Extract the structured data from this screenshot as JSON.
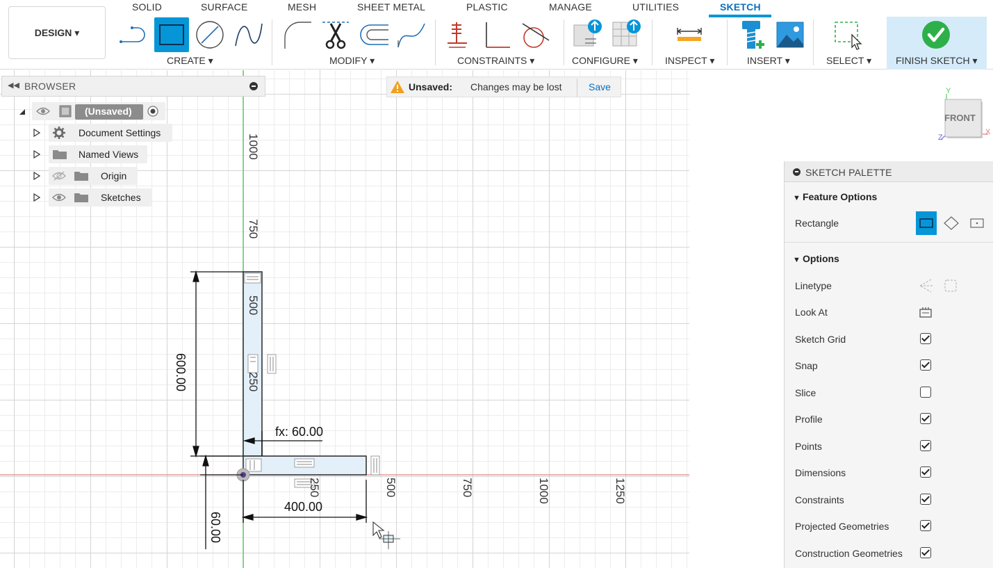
{
  "toolbar": {
    "tabs": [
      "SOLID",
      "SURFACE",
      "MESH",
      "SHEET METAL",
      "PLASTIC",
      "MANAGE",
      "UTILITIES",
      "SKETCH"
    ],
    "active_tab": "SKETCH",
    "design_label": "DESIGN ▾",
    "groups": {
      "create": "CREATE ▾",
      "modify": "MODIFY ▾",
      "constraints": "CONSTRAINTS ▾",
      "configure": "CONFIGURE ▾",
      "inspect": "INSPECT ▾",
      "insert": "INSERT ▾",
      "select": "SELECT ▾",
      "finish": "FINISH SKETCH ▾"
    },
    "colors": {
      "accent": "#0696d7",
      "finish_bg": "#d5ebfa",
      "finish_check": "#2db04a"
    }
  },
  "browser": {
    "title": "BROWSER",
    "root": "(Unsaved)",
    "items": [
      {
        "label": "Document Settings",
        "icon": "gear-icon"
      },
      {
        "label": "Named Views",
        "icon": "folder-icon"
      },
      {
        "label": "Origin",
        "icon": "folder-icon"
      },
      {
        "label": "Sketches",
        "icon": "folder-icon"
      }
    ]
  },
  "banner": {
    "label": "Unsaved:",
    "message": "Changes may be lost",
    "action": "Save"
  },
  "viewcube": {
    "face": "FRONT",
    "axis_y": "Y",
    "axis_z": "Z",
    "axis_x": "X"
  },
  "sketch": {
    "dimensions": {
      "height": "600.00",
      "width": "400.00",
      "thickness_expr": "fx: 60.00",
      "bottom_thickness": "60.00"
    },
    "vertical_ticks": [
      "1000",
      "750",
      "500",
      "250"
    ],
    "horizontal_ticks": [
      "250",
      "500",
      "750",
      "1000",
      "1250"
    ]
  },
  "palette": {
    "title": "SKETCH PALETTE",
    "feature_options": "Feature Options",
    "rectangle_label": "Rectangle",
    "options": "Options",
    "rows": [
      {
        "label": "Linetype",
        "type": "icons"
      },
      {
        "label": "Look At",
        "type": "icon"
      },
      {
        "label": "Sketch Grid",
        "checked": true
      },
      {
        "label": "Snap",
        "checked": true
      },
      {
        "label": "Slice",
        "checked": false
      },
      {
        "label": "Profile",
        "checked": true
      },
      {
        "label": "Points",
        "checked": true
      },
      {
        "label": "Dimensions",
        "checked": true
      },
      {
        "label": "Constraints",
        "checked": true
      },
      {
        "label": "Projected Geometries",
        "checked": true
      },
      {
        "label": "Construction Geometries",
        "checked": true
      }
    ]
  }
}
